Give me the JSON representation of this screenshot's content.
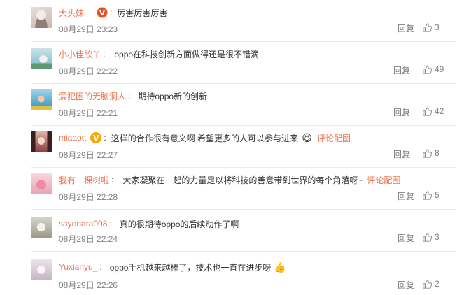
{
  "comments": [
    {
      "name": "大头妹一",
      "badge": "red-v",
      "text": "厉害厉害厉害",
      "link": "",
      "time": "08月29日 23:23",
      "reply": "回复",
      "likes": "3",
      "avatar_colors": [
        "#c9b8b0",
        "#e8ddd8"
      ]
    },
    {
      "name": "小小佳欣丫",
      "badge": "",
      "text": "oppo在科技创新方面做得还是很不错滴",
      "link": "",
      "time": "08月29日 22:22",
      "reply": "回复",
      "likes": "49",
      "avatar_colors": [
        "#7bb6c7",
        "#cde6ea"
      ]
    },
    {
      "name": "爱犯困的无脑洞人",
      "badge": "",
      "text": "期待oppo新的创新",
      "link": "",
      "time": "08月29日 22:21",
      "reply": "回复",
      "likes": "42",
      "avatar_colors": [
        "#2f8fbf",
        "#9fd3e6"
      ]
    },
    {
      "name": "miaaott",
      "badge": "gold-v",
      "text": "这样的合作很有意义啊 希望更多的人可以参与进来",
      "emoji": "😆",
      "link": "评论配图",
      "time": "08月29日 22:27",
      "reply": "回复",
      "likes": "8",
      "avatar_colors": [
        "#8a3c3c",
        "#e0b4a6"
      ]
    },
    {
      "name": "我有一棵树啦",
      "badge": "",
      "text": "大家凝聚在一起的力量足以将科技的善意带到世界的每个角落呀~",
      "link": "评论配图",
      "time": "08月29日 22:28",
      "reply": "回复",
      "likes": "5",
      "avatar_colors": [
        "#e6a3b3",
        "#f7d7df"
      ]
    },
    {
      "name": "sayonara008",
      "badge": "",
      "text": "真的很期待oppo的后续动作了啊",
      "link": "",
      "time": "08月29日 22:24",
      "reply": "回复",
      "likes": "3",
      "avatar_colors": [
        "#9a9a8a",
        "#d8d6cc"
      ]
    },
    {
      "name": "Yuxianyu_",
      "badge": "",
      "text": "oppo手机越来越棒了，技术也一直在进步呀",
      "emoji": "👍",
      "link": "",
      "time": "08月29日 22:26",
      "reply": "回复",
      "likes": "2",
      "avatar_colors": [
        "#c4b6c2",
        "#ece4ea"
      ]
    }
  ],
  "colors": {
    "name": "#eb7350",
    "meta": "#808080",
    "text": "#333333"
  }
}
